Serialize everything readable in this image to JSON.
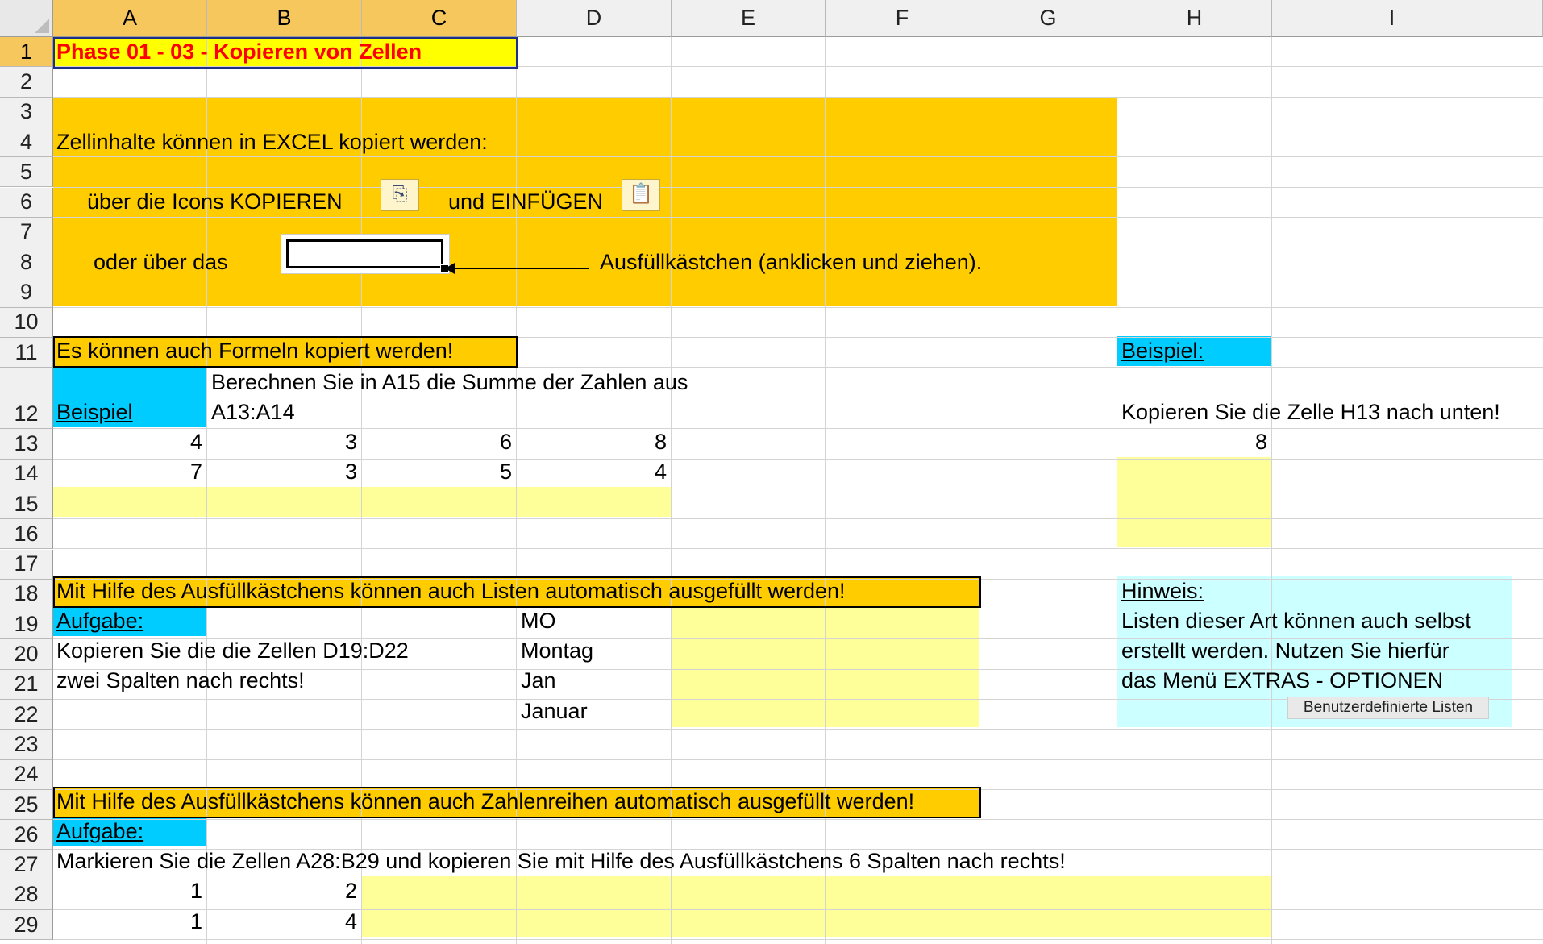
{
  "columns": [
    "A",
    "B",
    "C",
    "D",
    "E",
    "F",
    "G",
    "H",
    "I"
  ],
  "rows": [
    "1",
    "2",
    "3",
    "4",
    "5",
    "6",
    "7",
    "8",
    "9",
    "10",
    "11",
    "12",
    "13",
    "14",
    "15",
    "16",
    "17",
    "18",
    "19",
    "20",
    "21",
    "22",
    "23",
    "24",
    "25",
    "26",
    "27",
    "28",
    "29"
  ],
  "cells": {
    "A1": "Phase 01 - 03 - Kopieren von Zellen",
    "A4": "Zellinhalte können in EXCEL kopiert werden:",
    "A6_text1": "über die Icons KOPIEREN",
    "A6_text2": "und EINFÜGEN",
    "A8_text1": "oder über das",
    "A8_text2": "Ausfüllkästchen (anklicken und ziehen).",
    "A11": "Es können auch Formeln kopiert werden!",
    "A12": "Beispiel",
    "B12_line1": "Berechnen Sie in A15 die Summe der Zahlen aus",
    "B12_line2": "A13:A14",
    "A13": "4",
    "B13": "3",
    "C13": "6",
    "D13": "8",
    "A14": "7",
    "B14": "3",
    "C14": "5",
    "D14": "4",
    "H11": "Beispiel:",
    "H12": "Kopieren Sie die Zelle H13 nach unten!",
    "H13": "8",
    "A18": "Mit Hilfe des Ausfüllkästchens können auch Listen automatisch ausgefüllt werden!",
    "A19": "Aufgabe:",
    "A20": "Kopieren Sie die die Zellen D19:D22",
    "A21": "zwei Spalten nach rechts!",
    "D19": "MO",
    "D20": "Montag",
    "D21": "Jan",
    "D22": "Januar",
    "H18": "Hinweis:",
    "H19": "Listen dieser Art können auch selbst",
    "H20": "erstellt werden. Nutzen Sie hierfür",
    "H21": "das Menü EXTRAS - OPTIONEN",
    "H22_button": "Benutzerdefinierte Listen",
    "A25": "Mit Hilfe des Ausfüllkästchens können auch Zahlenreihen automatisch ausgefüllt werden!",
    "A26": "Aufgabe:",
    "A27": "Markieren Sie die Zellen A28:B29 und kopieren Sie mit Hilfe des Ausfüllkästchens 6 Spalten nach rechts!",
    "A28": "1",
    "B28": "2",
    "A29": "1",
    "B29": "4"
  },
  "icons": {
    "copy": "copy-icon",
    "paste": "paste-icon"
  },
  "colors": {
    "orange": "#ffcc00",
    "cyan": "#00ccff",
    "light_cyan": "#ccffff",
    "light_yellow": "#ffff99",
    "yellow": "#ffff00",
    "title_red": "#ff0000",
    "selected_header": "#f5c75d"
  }
}
